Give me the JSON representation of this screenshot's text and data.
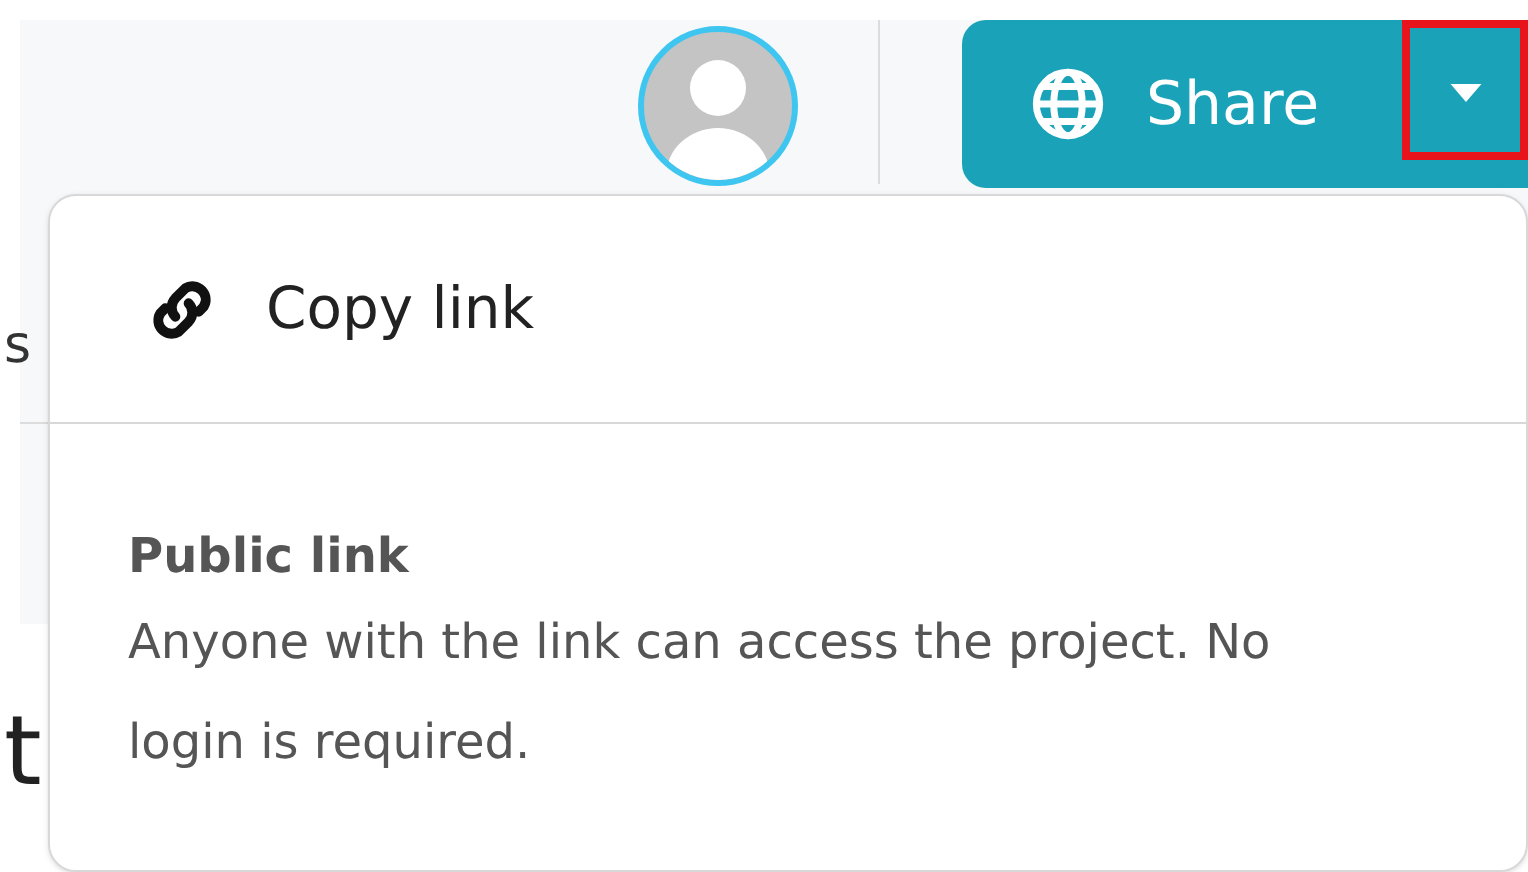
{
  "header": {
    "share_button": {
      "label": "Share"
    },
    "dropdown_toggle": {
      "highlighted": true
    }
  },
  "background_fragments": [
    "s",
    "t"
  ],
  "share_menu": {
    "copy_link": {
      "label": "Copy link"
    },
    "public_link": {
      "title": "Public link",
      "description": "Anyone with the link can access the project. No login is required."
    }
  }
}
